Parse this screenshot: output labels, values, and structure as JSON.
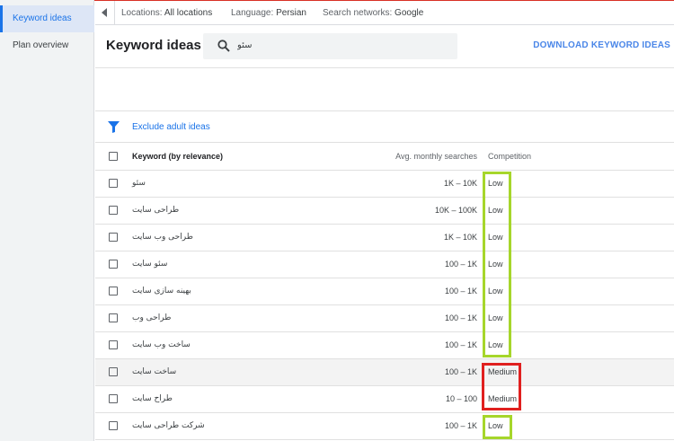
{
  "sidebar": {
    "items": [
      {
        "label": "Keyword ideas",
        "active": true
      },
      {
        "label": "Plan overview",
        "active": false
      }
    ]
  },
  "filters": {
    "locations_label": "Locations:",
    "locations_value": "All locations",
    "language_label": "Language:",
    "language_value": "Persian",
    "networks_label": "Search networks:",
    "networks_value": "Google"
  },
  "header": {
    "title": "Keyword ideas",
    "search_value": "سئو",
    "download_label": "DOWNLOAD KEYWORD IDEAS"
  },
  "filter_row": {
    "exclude_label": "Exclude adult ideas"
  },
  "table": {
    "columns": {
      "keyword": "Keyword (by relevance)",
      "searches": "Avg. monthly searches",
      "competition": "Competition"
    },
    "rows": [
      {
        "keyword": "سئو",
        "searches": "1K – 10K",
        "competition": "Low"
      },
      {
        "keyword": "طراحی سایت",
        "searches": "10K – 100K",
        "competition": "Low"
      },
      {
        "keyword": "طراحی وب سایت",
        "searches": "1K – 10K",
        "competition": "Low"
      },
      {
        "keyword": "سئو سایت",
        "searches": "100 – 1K",
        "competition": "Low"
      },
      {
        "keyword": "بهینه سازی سایت",
        "searches": "100 – 1K",
        "competition": "Low"
      },
      {
        "keyword": "طراحی وب",
        "searches": "100 – 1K",
        "competition": "Low"
      },
      {
        "keyword": "ساخت وب سایت",
        "searches": "100 – 1K",
        "competition": "Low"
      },
      {
        "keyword": "ساخت سایت",
        "searches": "100 – 1K",
        "competition": "Medium"
      },
      {
        "keyword": "طراح سایت",
        "searches": "10 – 100",
        "competition": "Medium"
      },
      {
        "keyword": "شرکت طراحی سایت",
        "searches": "100 – 1K",
        "competition": "Low"
      }
    ]
  },
  "colors": {
    "accent": "#1a73e8",
    "highlight_low": "#a6d62b",
    "highlight_medium": "#e0201f"
  },
  "icons": [
    "caret-left-icon",
    "search-icon",
    "filter-icon",
    "checkbox-icon"
  ]
}
